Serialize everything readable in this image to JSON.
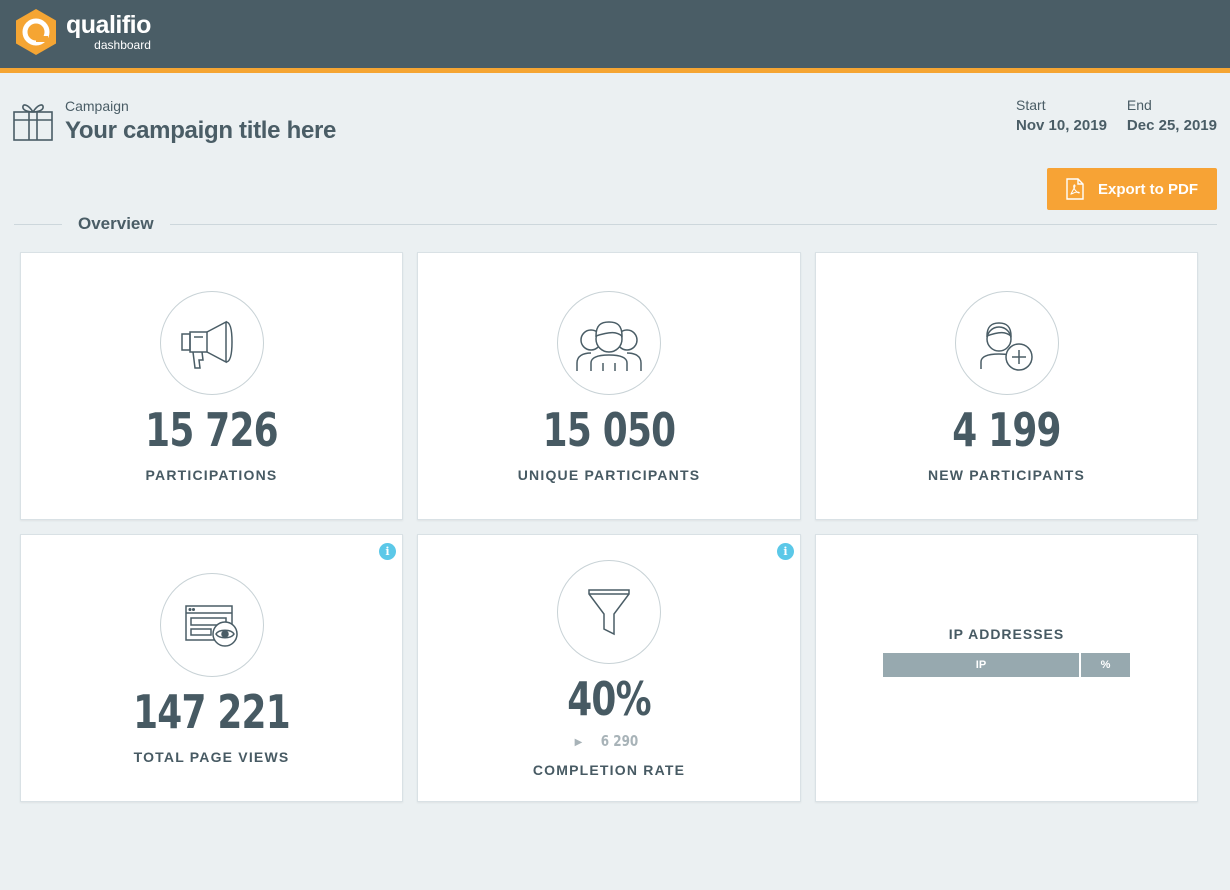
{
  "header": {
    "logo_name": "qualifio",
    "logo_sub": "dashboard",
    "accent_color": "#f5a533",
    "bar_color": "#4a5d66"
  },
  "campaign": {
    "label": "Campaign",
    "title": "Your campaign title here",
    "start_label": "Start",
    "start_value": "Nov 10, 2019",
    "end_label": "End",
    "end_value": "Dec 25, 2019"
  },
  "actions": {
    "export_label": "Export to PDF"
  },
  "overview": {
    "title": "Overview",
    "cards": [
      {
        "icon": "megaphone-icon",
        "value": "15 726",
        "label": "PARTICIPATIONS"
      },
      {
        "icon": "group-users-icon",
        "value": "15 050",
        "label": "UNIQUE PARTICIPANTS"
      },
      {
        "icon": "add-user-icon",
        "value": "4 199",
        "label": "NEW PARTICIPANTS"
      },
      {
        "icon": "browser-eye-icon",
        "value": "147 221",
        "label": "TOTAL PAGE VIEWS",
        "info": "i"
      },
      {
        "icon": "funnel-icon",
        "value": "40%",
        "sub_value": "6 290",
        "label": "COMPLETION RATE",
        "info": "i"
      }
    ],
    "ip": {
      "title": "IP ADDRESSES",
      "col_ip": "IP",
      "col_pct": "%"
    }
  }
}
